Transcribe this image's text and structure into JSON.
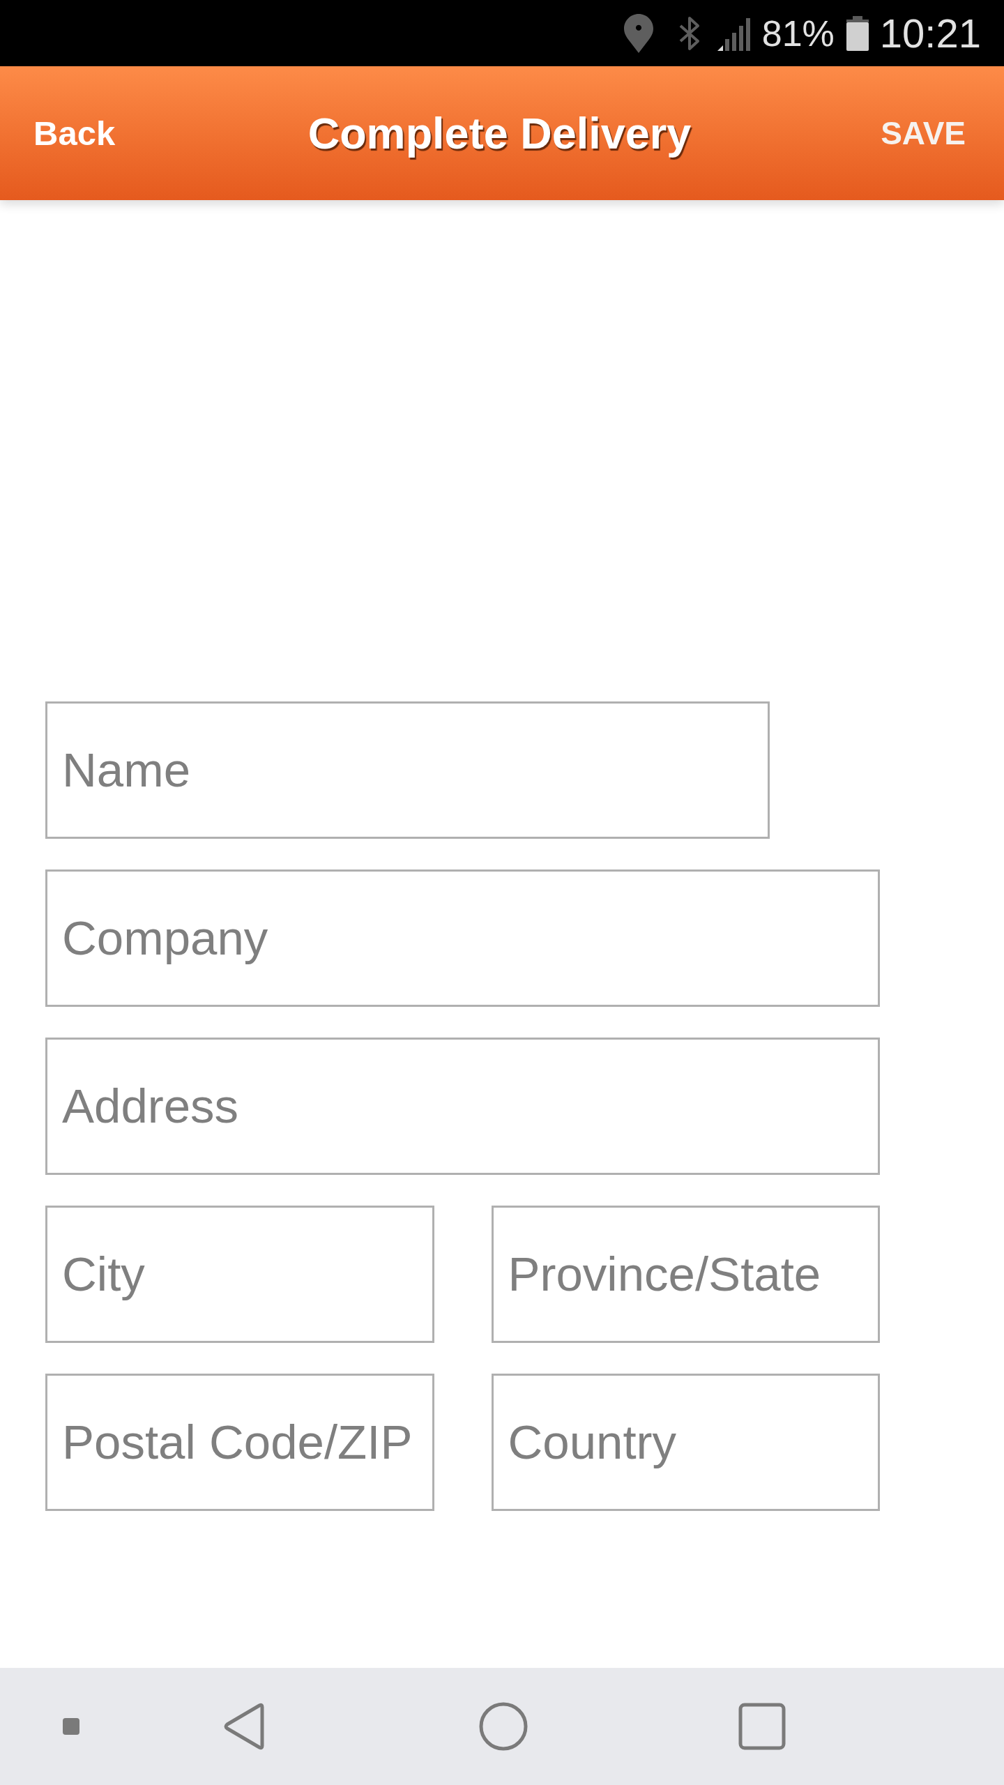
{
  "status_bar": {
    "battery": "81%",
    "time": "10:21"
  },
  "header": {
    "back": "Back",
    "title": "Complete Delivery",
    "save": "SAVE"
  },
  "form": {
    "rows": [
      [
        {
          "placeholder": "Name"
        }
      ],
      [
        {
          "placeholder": "Company"
        }
      ],
      [
        {
          "placeholder": "Address"
        }
      ],
      [
        {
          "placeholder": "City"
        },
        {
          "placeholder": "Province/State"
        }
      ],
      [
        {
          "placeholder": "Postal Code/ZIP"
        },
        {
          "placeholder": "Country"
        }
      ]
    ]
  }
}
